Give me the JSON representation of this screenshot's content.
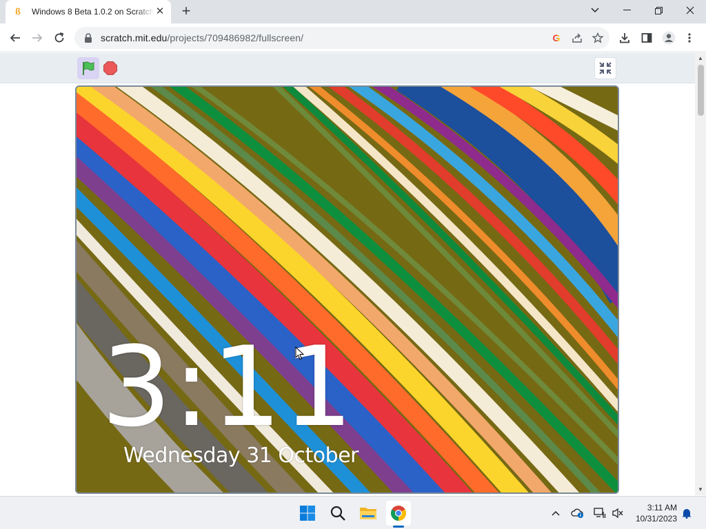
{
  "browser": {
    "tab": {
      "title": "Windows 8 Beta 1.0.2 on Scratch",
      "favicon": "scratch-cat-icon"
    },
    "omnibox": {
      "domain": "scratch.mit.edu",
      "path": "/projects/709486982/fullscreen/"
    }
  },
  "scratch": {
    "clock": {
      "time": "3:11",
      "date": "Wednesday  31  October"
    }
  },
  "taskbar": {
    "time": "3:11 AM",
    "date": "10/31/2023"
  },
  "colors": {
    "accent": "#0067c0",
    "stop": "#e04c4c",
    "flag": "#4cbf56"
  }
}
